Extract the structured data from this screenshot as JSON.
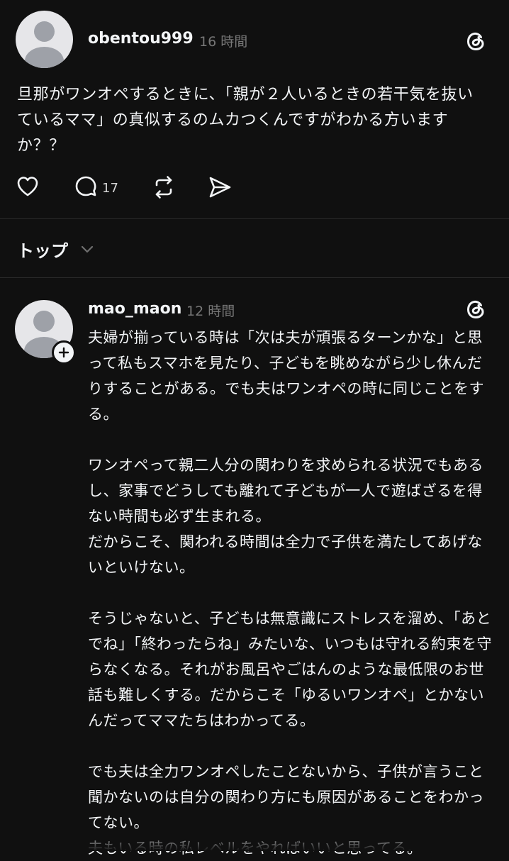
{
  "post": {
    "username": "obentou999",
    "time": "16 時間",
    "text": "旦那がワンオペするときに、「親が２人いるときの若干気を抜いているママ」の真似するのムカつくんですがわかる方いますか？？",
    "reply_count": "17",
    "icons": [
      "threads-logo-icon",
      "heart-icon",
      "comment-icon",
      "repost-icon",
      "share-icon"
    ]
  },
  "sort": {
    "label": "トップ",
    "icon": "chevron-down-icon"
  },
  "reply": {
    "username": "mao_maon",
    "time": "12 時間",
    "paragraphs": [
      "夫婦が揃っている時は「次は夫が頑張るターンかな」と思って私もスマホを見たり、子どもを眺めながら少し休んだりすることがある。でも夫はワンオペの時に同じことをする。",
      "ワンオペって親二人分の関わりを求められる状況でもあるし、家事でどうしても離れて子どもが一人で遊ばざるを得ない時間も必ず生まれる。\nだからこそ、関われる時間は全力で子供を満たしてあげないといけない。",
      "そうじゃないと、子どもは無意識にストレスを溜め、「あとでね」「終わったらね」みたいな、いつもは守れる約束を守らなくなる。それがお風呂やごはんのような最低限のお世話も難しくする。だからこそ「ゆるいワンオペ」とかないんだってママたちはわかってる。",
      "でも夫は全力ワンオペしたことないから、子供が言うこと聞かないのは自分の関わり方にも原因があることをわかってない。\n夫もいる時の私レベルをやればいいと思ってる。"
    ],
    "icons": [
      "threads-logo-icon",
      "follow-plus-icon"
    ]
  },
  "colors": {
    "background": "#101010",
    "text": "#f3f5f7",
    "muted": "#777777",
    "avatar_bg": "#e6e6e9",
    "avatar_fg": "#9ea1a8"
  }
}
